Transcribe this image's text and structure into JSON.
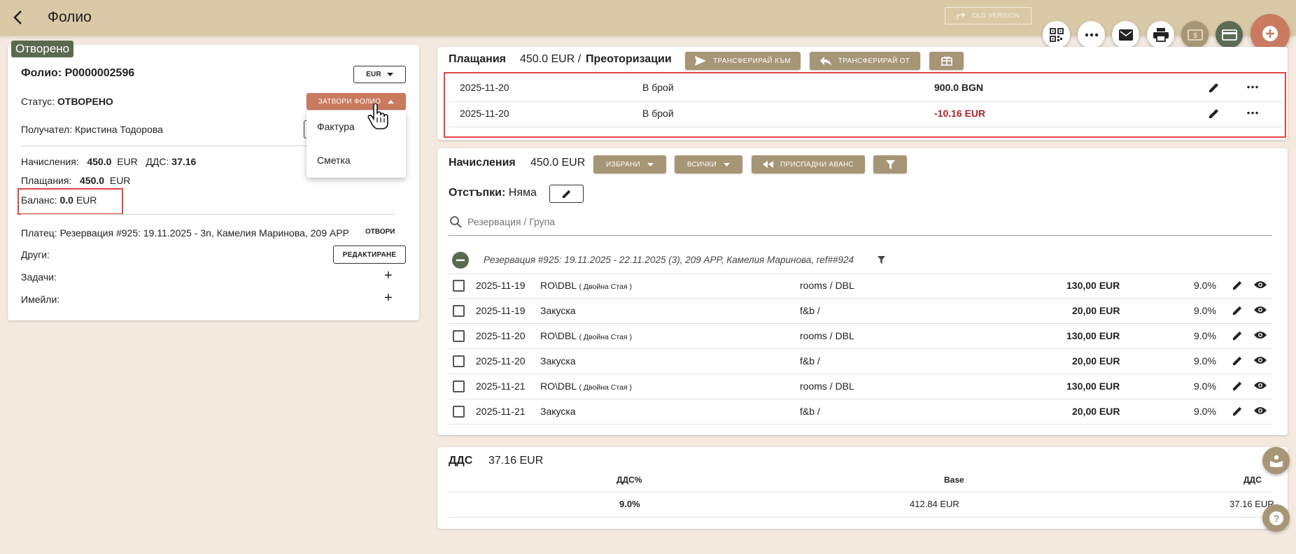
{
  "header": {
    "title": "Фолио",
    "old_version": "OLD VERSION"
  },
  "folio": {
    "status_tag": "Отворено",
    "number_label": "Фолио:",
    "number": "P0000002596",
    "currency": "EUR",
    "status_label": "Статус:",
    "status_value": "ОТВОРЕНО",
    "close_button": "ЗАТВОРИ ФОЛИО",
    "recipient_label": "Получател:",
    "recipient_value": "Кристина Тодорова",
    "charges_label": "Начисления:",
    "charges_value": "450.0",
    "charges_currency": "EUR",
    "vat_label": "ДДС:",
    "vat_value": "37.16",
    "payments_label": "Плащания:",
    "payments_value": "450.0",
    "payments_currency": "EUR",
    "balance_label": "Баланс:",
    "balance_value": "0.0",
    "balance_currency": "EUR",
    "payer_label": "Платец:",
    "payer_value": "Резервация #925: 19.11.2025 - 3n, Камелия Маринова, 209 APP",
    "open_link": "ОТВОРИ",
    "others_label": "Други:",
    "edit_button": "РЕДАКТИРАНЕ",
    "tasks_label": "Задачи:",
    "emails_label": "Имейли:",
    "dropdown_items": [
      "Фактура",
      "Сметка"
    ]
  },
  "payments": {
    "title": "Плащания",
    "amount": "450.0 EUR /",
    "reauth": "Преоторизации",
    "transfer_to": "ТРАНСФЕРИРАЙ КЪМ",
    "transfer_from": "ТРАНСФЕРИРАЙ ОТ",
    "rows": [
      {
        "date": "2025-11-20",
        "method": "В брой",
        "amount": "900.0 BGN",
        "negative": false
      },
      {
        "date": "2025-11-20",
        "method": "В брой",
        "amount": "-10.16 EUR",
        "negative": true
      }
    ]
  },
  "charges": {
    "title": "Начисления",
    "amount": "450.0 EUR",
    "selected_btn": "ИЗБРАНИ",
    "all_btn": "ВСИЧКИ",
    "deduct_btn": "ПРИСПАДНИ АВАНС",
    "discounts_label": "Отстъпки:",
    "discounts_value": "Няма",
    "search_placeholder": "Резервация / Група",
    "group_label": "Резервация #925: 19.11.2025 - 22.11.2025 (3), 209 APP, Камелия Маринова, ref##924",
    "rows": [
      {
        "date": "2025-11-19",
        "desc": "RO\\DBL",
        "sub": "( Двойна Стая )",
        "cat": "rooms / DBL",
        "amount": "130,00 EUR",
        "vat": "9.0%"
      },
      {
        "date": "2025-11-19",
        "desc": "Закуска",
        "sub": "",
        "cat": "f&b /",
        "amount": "20,00 EUR",
        "vat": "9.0%"
      },
      {
        "date": "2025-11-20",
        "desc": "RO\\DBL",
        "sub": "( Двойна Стая )",
        "cat": "rooms / DBL",
        "amount": "130,00 EUR",
        "vat": "9.0%"
      },
      {
        "date": "2025-11-20",
        "desc": "Закуска",
        "sub": "",
        "cat": "f&b /",
        "amount": "20,00 EUR",
        "vat": "9.0%"
      },
      {
        "date": "2025-11-21",
        "desc": "RO\\DBL",
        "sub": "( Двойна Стая )",
        "cat": "rooms / DBL",
        "amount": "130,00 EUR",
        "vat": "9.0%"
      },
      {
        "date": "2025-11-21",
        "desc": "Закуска",
        "sub": "",
        "cat": "f&b /",
        "amount": "20,00 EUR",
        "vat": "9.0%"
      }
    ]
  },
  "vat": {
    "title": "ДДС",
    "amount": "37.16 EUR",
    "col_rate": "ДДС%",
    "col_base": "Base",
    "col_vat": "ДДС",
    "rate": "9.0%",
    "base": "412.84 EUR",
    "vat": "37.16 EUR"
  },
  "colors": {
    "header": "#d9c9a6",
    "accent_tan": "#a69676",
    "close_button": "#c97a5f",
    "status_green": "#5a6a4f",
    "negative": "#b0222a",
    "highlight": "#e04545"
  }
}
